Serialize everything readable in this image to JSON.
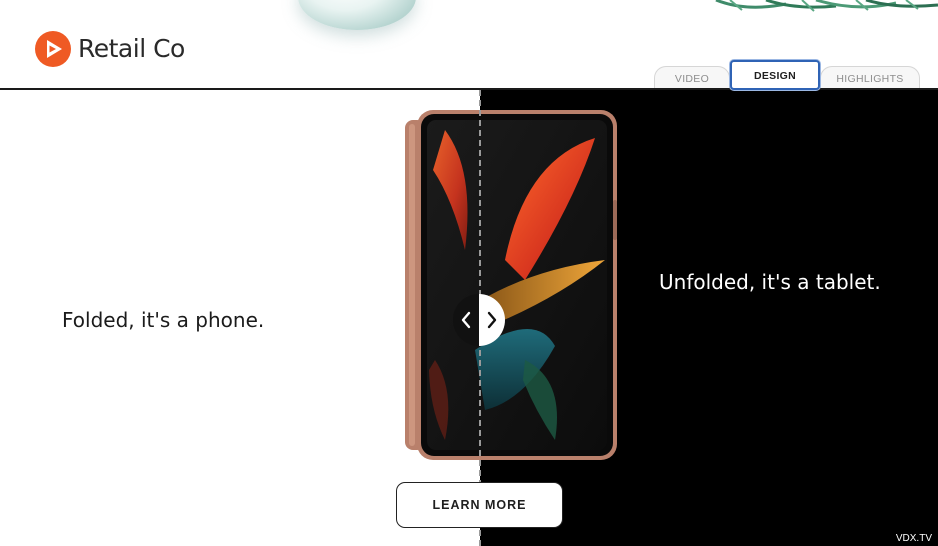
{
  "brand": {
    "name": "Retail Co",
    "logo_icon": "play-arrow-circle-icon",
    "accent": "#ef5a24"
  },
  "tabs": [
    {
      "label": "VIDEO",
      "active": false
    },
    {
      "label": "DESIGN",
      "active": true
    },
    {
      "label": "HIGHLIGHTS",
      "active": false
    }
  ],
  "comparison": {
    "left_caption": "Folded, it's a phone.",
    "right_caption": "Unfolded, it's a tablet.",
    "handle_left_icon": "chevron-left-icon",
    "handle_right_icon": "chevron-right-icon"
  },
  "cta": {
    "label": "LEARN MORE"
  },
  "badge": {
    "label": "VDX.TV"
  },
  "colors": {
    "left_background": "#ffffff",
    "right_background": "#000000",
    "active_tab_border": "#2f63b5",
    "phone_frame": "#b9806b"
  }
}
